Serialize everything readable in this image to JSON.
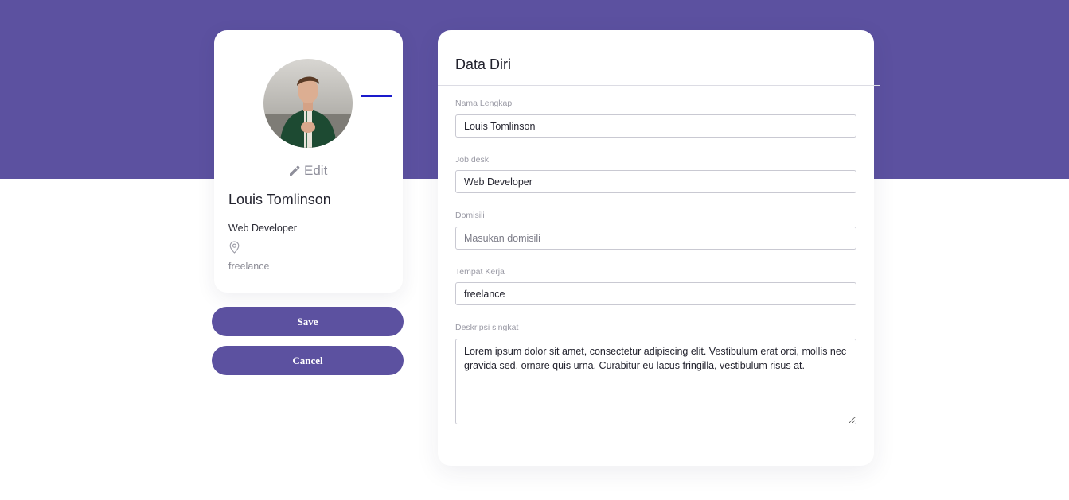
{
  "colors": {
    "brand": "#5c51a0",
    "accent_line": "#1a1acc"
  },
  "profile": {
    "name": "Louis Tomlinson",
    "job": "Web Developer",
    "workplace": "freelance",
    "edit_label": "Edit",
    "edit_icon": "pencil-icon",
    "location_icon": "map-pin-icon"
  },
  "actions": {
    "save_label": "Save",
    "cancel_label": "Cancel"
  },
  "form": {
    "title": "Data Diri",
    "fields": [
      {
        "label": "Nama Lengkap",
        "value": "Louis Tomlinson",
        "placeholder": ""
      },
      {
        "label": "Job desk",
        "value": "Web Developer",
        "placeholder": ""
      },
      {
        "label": "Domisili",
        "value": "",
        "placeholder": "Masukan domisili"
      },
      {
        "label": "Tempat Kerja",
        "value": "freelance",
        "placeholder": ""
      }
    ],
    "description": {
      "label": "Deskripsi singkat",
      "value": "Lorem ipsum dolor sit amet, consectetur adipiscing elit. Vestibulum erat orci, mollis nec gravida sed, ornare quis urna. Curabitur eu lacus fringilla, vestibulum risus at."
    }
  }
}
